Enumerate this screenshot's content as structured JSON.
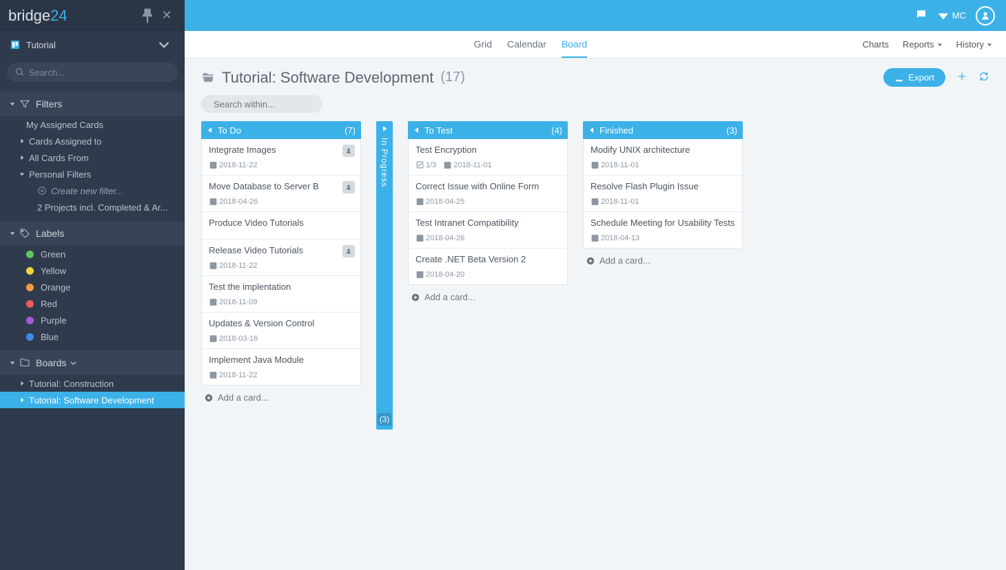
{
  "app_name": "bridge",
  "app_suffix": "24",
  "workspace": "Tutorial",
  "search_placeholder": "Search...",
  "sections": {
    "filters": {
      "title": "Filters",
      "my_assigned": "My Assigned Cards",
      "cards_assigned_to": "Cards Assigned to",
      "all_cards_from": "All Cards From",
      "personal_filters": "Personal Filters",
      "create_new": "Create new filter...",
      "saved_filter": "2 Projects incl. Completed & Ar..."
    },
    "labels": {
      "title": "Labels",
      "items": [
        {
          "name": "Green",
          "color": "#5cc95c"
        },
        {
          "name": "Yellow",
          "color": "#f0d43a"
        },
        {
          "name": "Orange",
          "color": "#ff9b3b"
        },
        {
          "name": "Red",
          "color": "#f05a5a"
        },
        {
          "name": "Purple",
          "color": "#a35cd6"
        },
        {
          "name": "Blue",
          "color": "#3b8de8"
        }
      ]
    },
    "boards": {
      "title": "Boards",
      "items": [
        {
          "name": "Tutorial: Construction",
          "selected": false
        },
        {
          "name": "Tutorial: Software Development",
          "selected": true
        }
      ]
    }
  },
  "user_initials": "MC",
  "tabs": {
    "grid": "Grid",
    "calendar": "Calendar",
    "board": "Board",
    "active": "board"
  },
  "right_menu": {
    "charts": "Charts",
    "reports": "Reports",
    "history": "History"
  },
  "page": {
    "title": "Tutorial: Software Development",
    "count": "(17)",
    "export": "Export",
    "search_within": "Search within..."
  },
  "columns": [
    {
      "title": "To Do",
      "count": "(7)",
      "collapsed": false,
      "cards": [
        {
          "title": "Integrate Images",
          "date": "2018-11-22",
          "member": true
        },
        {
          "title": "Move Database to Server B",
          "date": "2018-04-26",
          "member": true
        },
        {
          "title": "Produce Video Tutorials"
        },
        {
          "title": "Release Video Tutorials",
          "date": "2018-11-22",
          "member": true
        },
        {
          "title": "Test the implentation",
          "date": "2018-11-09"
        },
        {
          "title": "Updates & Version Control",
          "date": "2018-03-16"
        },
        {
          "title": "Implement Java Module",
          "date": "2018-11-22"
        }
      ]
    },
    {
      "title": "In Progress",
      "count": "(3)",
      "collapsed": true
    },
    {
      "title": "To Test",
      "count": "(4)",
      "collapsed": false,
      "cards": [
        {
          "title": "Test Encryption",
          "date": "2018-11-01",
          "checklist": "1/3"
        },
        {
          "title": "Correct Issue with Online Form",
          "date": "2018-04-25"
        },
        {
          "title": "Test Intranet Compatibility",
          "date": "2018-04-26"
        },
        {
          "title": "Create .NET Beta Version 2",
          "date": "2018-04-20"
        }
      ]
    },
    {
      "title": "Finished",
      "count": "(3)",
      "collapsed": false,
      "cards": [
        {
          "title": "Modify UNIX architecture",
          "date": "2018-11-01"
        },
        {
          "title": "Resolve Flash Plugin Issue",
          "date": "2018-11-01"
        },
        {
          "title": "Schedule Meeting for Usability Tests",
          "date": "2018-04-13"
        }
      ]
    }
  ],
  "add_card_label": "Add a card..."
}
